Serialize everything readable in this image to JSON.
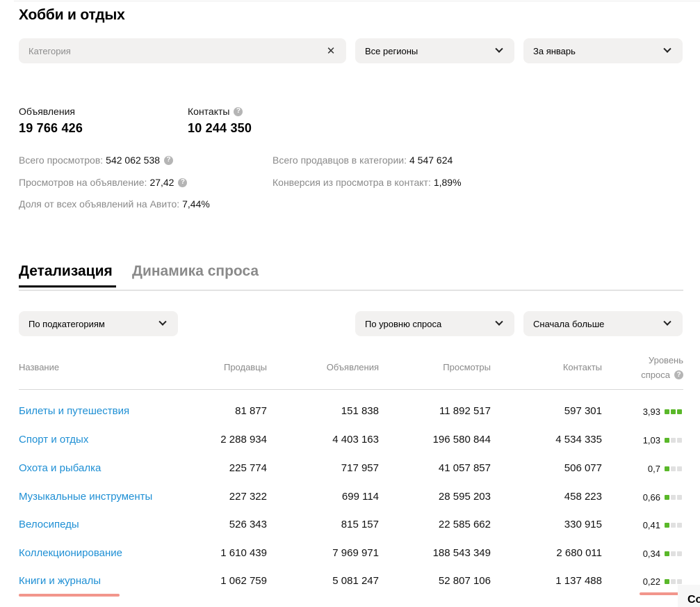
{
  "page": {
    "title": "Хобби и отдых"
  },
  "filters": {
    "category_placeholder": "Категория",
    "region": "Все регионы",
    "period": "За январь"
  },
  "summary": {
    "ads_label": "Объявления",
    "ads_value": "19 766 426",
    "contacts_label": "Контакты",
    "contacts_value": "10 244 350"
  },
  "metrics": {
    "total_views_label": "Всего просмотров:",
    "total_views_value": "542 062 538",
    "views_per_ad_label": "Просмотров на объявление:",
    "views_per_ad_value": "27,42",
    "share_label": "Доля от всех объявлений на Авито:",
    "share_value": "7,44%",
    "sellers_label": "Всего продавцов в категории:",
    "sellers_value": "4 547 624",
    "conversion_label": "Конверсия из просмотра в контакт:",
    "conversion_value": "1,89%"
  },
  "tabs": {
    "detail": "Детализация",
    "dynamics": "Динамика спроса"
  },
  "table_controls": {
    "group_by": "По подкатегориям",
    "sort_field": "По уровню спроса",
    "sort_order": "Сначала больше"
  },
  "table": {
    "headers": {
      "name": "Название",
      "sellers": "Продавцы",
      "ads": "Объявления",
      "views": "Просмотры",
      "contacts": "Контакты",
      "demand_line1": "Уровень",
      "demand_line2": "спроса"
    },
    "rows": [
      {
        "name": "Билеты и путешествия",
        "sellers": "81 877",
        "ads": "151 838",
        "views": "11 892 517",
        "contacts": "597 301",
        "demand": "3,93",
        "level": 3
      },
      {
        "name": "Спорт и отдых",
        "sellers": "2 288 934",
        "ads": "4 403 163",
        "views": "196 580 844",
        "contacts": "4 534 335",
        "demand": "1,03",
        "level": 1
      },
      {
        "name": "Охота и рыбалка",
        "sellers": "225 774",
        "ads": "717 957",
        "views": "41 057 857",
        "contacts": "506 077",
        "demand": "0,7",
        "level": 1
      },
      {
        "name": "Музыкальные инструменты",
        "sellers": "227 322",
        "ads": "699 114",
        "views": "28 595 203",
        "contacts": "458 223",
        "demand": "0,66",
        "level": 1
      },
      {
        "name": "Велосипеды",
        "sellers": "526 343",
        "ads": "815 157",
        "views": "22 585 662",
        "contacts": "330 915",
        "demand": "0,41",
        "level": 1
      },
      {
        "name": "Коллекционирование",
        "sellers": "1 610 439",
        "ads": "7 969 971",
        "views": "188 543 349",
        "contacts": "2 680 011",
        "demand": "0,34",
        "level": 1
      },
      {
        "name": "Книги и журналы",
        "sellers": "1 062 759",
        "ads": "5 081 247",
        "views": "52 807 106",
        "contacts": "1 137 488",
        "demand": "0,22",
        "level": 1
      }
    ]
  },
  "corner_fragment": "Co",
  "colors": {
    "link": "#1e8fd4",
    "level_on": "#5ab82a",
    "level_off": "#e0e0e0",
    "annotation": "#f2968c"
  }
}
